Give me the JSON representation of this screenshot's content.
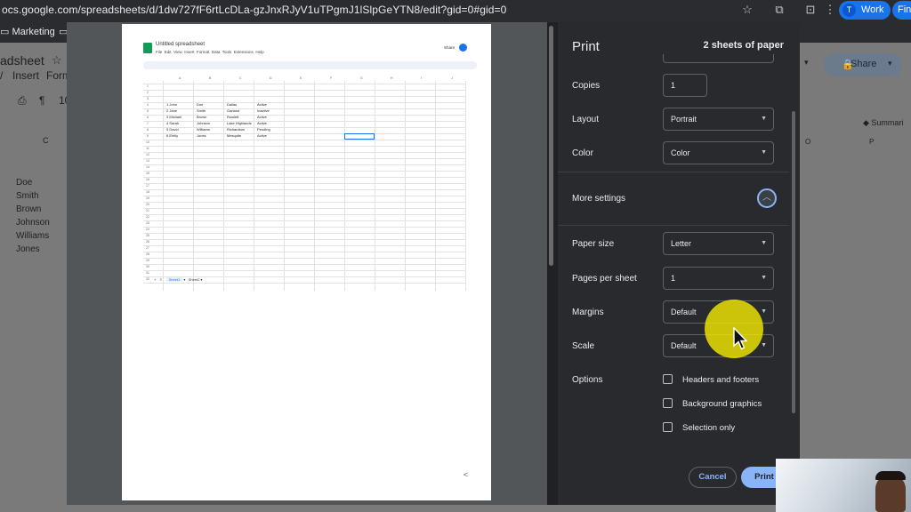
{
  "browser": {
    "url": "ocs.google.com/spreadsheets/d/1dw727fF6rtLcDLa-gzJnxRJyV1uTPgmJ1lSlpGeYTN8/edit?gid=0#gid=0",
    "profile_label": "Work",
    "profile_initial": "T",
    "find_label": "Fin",
    "bookmark": "Marketing"
  },
  "sheet_background": {
    "doc_title": "adsheet",
    "menu": [
      "/",
      "Insert",
      "Form"
    ],
    "share_label": "Share",
    "summary_label": "Summari",
    "col_c": "C",
    "col_o": "O",
    "col_p": "P",
    "last_names": [
      "Doe",
      "Smith",
      "Brown",
      "Johnson",
      "Williams",
      "Jones"
    ]
  },
  "preview": {
    "title": "Untitled spreadsheet",
    "menu": [
      "File",
      "Edit",
      "View",
      "Insert",
      "Format",
      "Data",
      "Tools",
      "Extensions",
      "Help"
    ],
    "share": "Share",
    "columns": [
      "A",
      "B",
      "C",
      "D",
      "E",
      "F",
      "G",
      "H",
      "I",
      "J",
      "K"
    ],
    "rows": [
      {
        "num": "1",
        "first": "John",
        "last": "Doe",
        "city": "Dallas",
        "status": "Active"
      },
      {
        "num": "2",
        "first": "Jane",
        "last": "Smith",
        "city": "Garland",
        "status": "Inactive"
      },
      {
        "num": "3",
        "first": "Michael",
        "last": "Brown",
        "city": "Rowlett",
        "status": "Active"
      },
      {
        "num": "4",
        "first": "Sarah",
        "last": "Johnson",
        "city": "Lake Highlands",
        "status": "Active"
      },
      {
        "num": "5",
        "first": "David",
        "last": "Williams",
        "city": "Richardson",
        "status": "Pending"
      },
      {
        "num": "6",
        "first": "Emily",
        "last": "Jones",
        "city": "Mesquite",
        "status": "Active"
      }
    ],
    "tabs": [
      "Sheet1",
      "Sheet2"
    ],
    "page_marker": "<"
  },
  "print": {
    "title": "Print",
    "sheets_of_paper": "2 sheets of paper",
    "copies_label": "Copies",
    "copies_value": "1",
    "layout_label": "Layout",
    "layout_value": "Portrait",
    "color_label": "Color",
    "color_value": "Color",
    "more_settings_label": "More settings",
    "paper_size_label": "Paper size",
    "paper_size_value": "Letter",
    "pages_per_sheet_label": "Pages per sheet",
    "pages_per_sheet_value": "1",
    "margins_label": "Margins",
    "margins_value": "Default",
    "scale_label": "Scale",
    "scale_value": "Default",
    "options_label": "Options",
    "options": [
      {
        "label": "Headers and footers",
        "checked": false
      },
      {
        "label": "Background graphics",
        "checked": false
      },
      {
        "label": "Selection only",
        "checked": false
      }
    ],
    "cancel_label": "Cancel",
    "print_label": "Print"
  },
  "colors": {
    "accent": "#8ab4f8",
    "highlight": "#f0e600"
  }
}
